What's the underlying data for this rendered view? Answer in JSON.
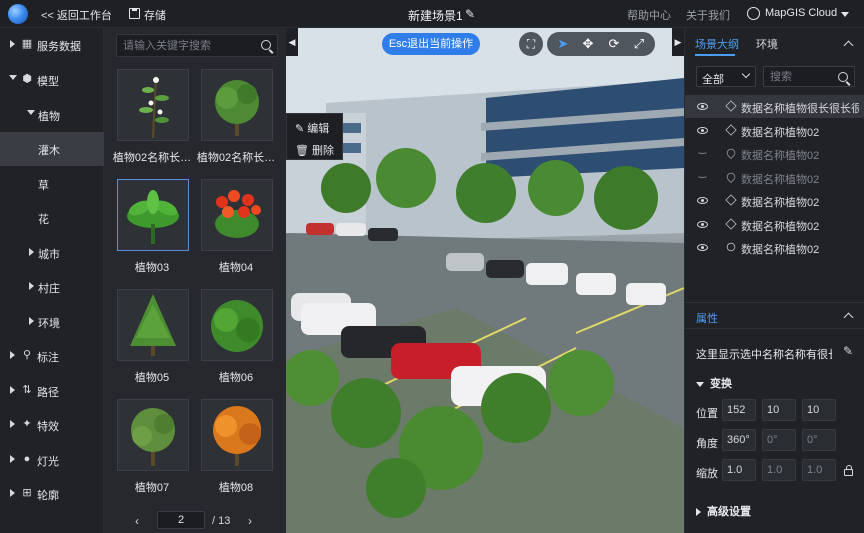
{
  "topbar": {
    "back_label": "<< 返回工作台",
    "save_label": "存储",
    "scene_title": "新建场景1",
    "help_label": "帮助中心",
    "about_label": "关于我们",
    "user_label": "MapGIS Cloud"
  },
  "leftnav": {
    "items": [
      {
        "label": "服务数据",
        "icon": "grid-icon"
      },
      {
        "label": "模型",
        "icon": "cube-icon"
      },
      {
        "label": "植物"
      },
      {
        "label": "灌木"
      },
      {
        "label": "草"
      },
      {
        "label": "花"
      },
      {
        "label": "城市"
      },
      {
        "label": "村庄"
      },
      {
        "label": "环境"
      },
      {
        "label": "标注",
        "icon": "pin-icon"
      },
      {
        "label": "路径",
        "icon": "path-icon"
      },
      {
        "label": "特效",
        "icon": "effect-icon"
      },
      {
        "label": "灯光",
        "icon": "bulb-icon"
      },
      {
        "label": "轮廓",
        "icon": "outline-icon"
      }
    ]
  },
  "modelpanel": {
    "search_placeholder": "请输入关键字搜索",
    "items": [
      {
        "label": "植物02名称长…"
      },
      {
        "label": "植物02名称长…"
      },
      {
        "label": "植物03"
      },
      {
        "label": "植物04"
      },
      {
        "label": "植物05"
      },
      {
        "label": "植物06"
      },
      {
        "label": "植物07"
      },
      {
        "label": "植物08"
      }
    ],
    "pager": {
      "prev": "‹",
      "next": "›",
      "current": "2",
      "total": "/ 13"
    }
  },
  "contextmenu": {
    "edit_label": "编辑",
    "delete_label": "删除"
  },
  "viewport": {
    "esc_label": "Esc退出当前操作",
    "left_toggle": "◀",
    "right_toggle": "▶"
  },
  "rightpanel": {
    "tabs": [
      {
        "label": "场景大纲"
      },
      {
        "label": "环境"
      }
    ],
    "filter_value": "全部",
    "search_placeholder": "搜索",
    "tree": [
      {
        "label": "数据名称植物很长很长很长",
        "visible": true,
        "icon": "cube",
        "selected": true
      },
      {
        "label": "数据名称植物02",
        "visible": true,
        "icon": "cube"
      },
      {
        "label": "数据名称植物02",
        "visible": false,
        "icon": "pin"
      },
      {
        "label": "数据名称植物02",
        "visible": false,
        "icon": "pin"
      },
      {
        "label": "数据名称植物02",
        "visible": true,
        "icon": "cube"
      },
      {
        "label": "数据名称植物02",
        "visible": true,
        "icon": "cube"
      },
      {
        "label": "数据名称植物02",
        "visible": true,
        "icon": "bulb"
      }
    ],
    "properties": {
      "title": "属性",
      "description": "这里显示选中名称名称有很长很长",
      "transform_title": "变换",
      "position_label": "位置",
      "position": [
        "152",
        "10",
        "10"
      ],
      "rotation_label": "角度",
      "rotation": [
        "360°",
        "0°",
        "0°"
      ],
      "scale_label": "缩放",
      "scale": [
        "1.0",
        "1.0",
        "1.0"
      ],
      "advanced_title": "高级设置"
    }
  },
  "colors": {
    "accent": "#4e9df5",
    "esc_button": "#2f7de8",
    "panel_bg": "#202226"
  }
}
